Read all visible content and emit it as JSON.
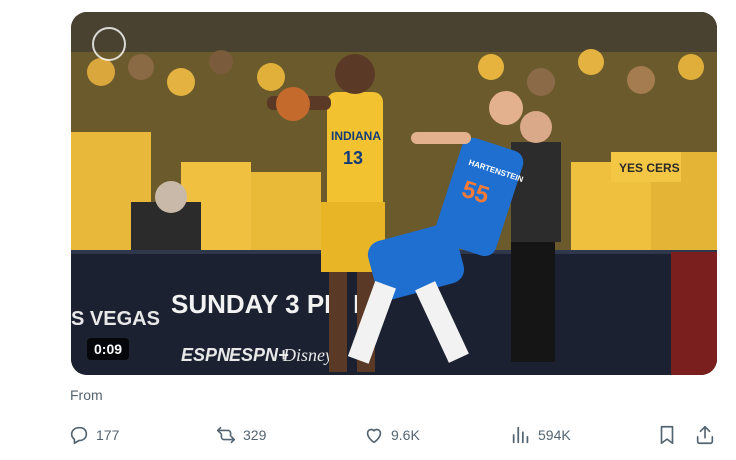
{
  "tweet": {
    "media": {
      "duration": "0:09",
      "jersey_left": {
        "team": "INDIANA",
        "number": "13"
      },
      "jersey_right": {
        "name": "HARTENSTEIN",
        "number": "55"
      },
      "board_text_left": "S VEGAS",
      "board_text_main": "SUNDAY 3 PM E",
      "network_logos": [
        "ESPN",
        "ESPN+",
        "Disney"
      ],
      "fan_shirt_text": "YES CERS"
    },
    "source_label": "From"
  },
  "actions": {
    "replies": "177",
    "reposts": "329",
    "likes": "9.6K",
    "views": "594K"
  },
  "icons": [
    "reply-icon",
    "repost-icon",
    "like-icon",
    "views-icon",
    "bookmark-icon",
    "share-icon"
  ],
  "colors": {
    "muted_text": "#536471",
    "pacers_gold": "#f2c230",
    "thunder_blue": "#1f6fd1",
    "board_dark": "#1b2130"
  }
}
